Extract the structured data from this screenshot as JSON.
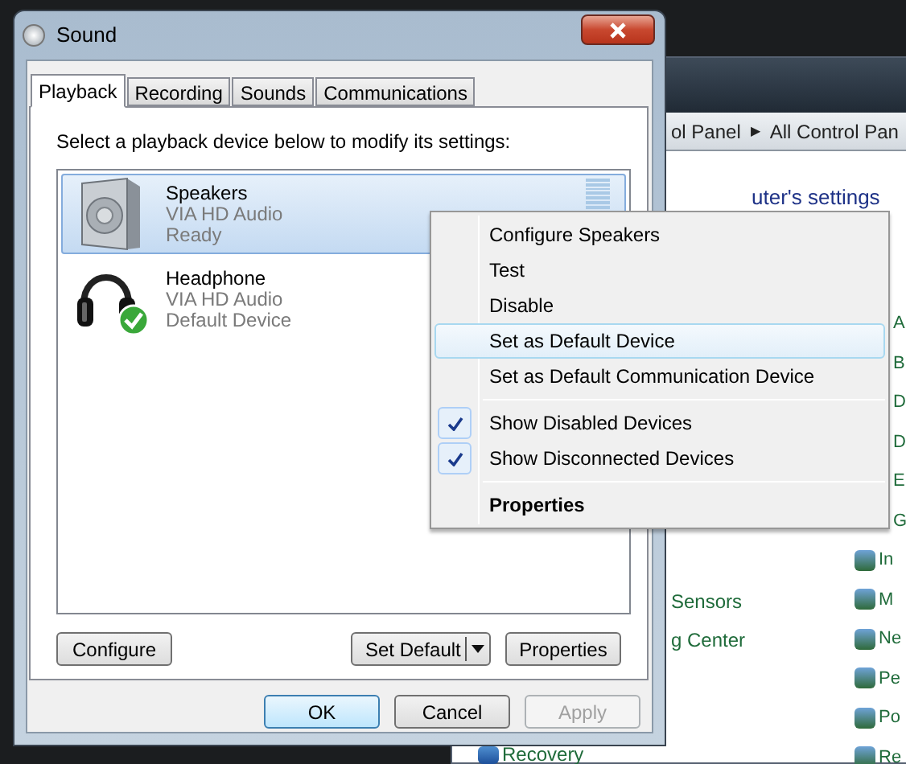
{
  "background_window": {
    "address": [
      "ol Panel",
      "All Control Pan"
    ],
    "address_separator": "▶",
    "heading": "uter's settings",
    "right_items": [
      {
        "label": "A",
        "icon": false
      },
      {
        "label": "B",
        "icon": false
      },
      {
        "label": "D",
        "icon": false
      },
      {
        "label": "D",
        "icon": false
      },
      {
        "label": "E",
        "icon": false
      },
      {
        "label": "G",
        "icon": false
      },
      {
        "label": "In",
        "icon": true
      },
      {
        "label": "M",
        "icon": true
      },
      {
        "label": "Ne",
        "icon": true
      },
      {
        "label": "Pe",
        "icon": true
      },
      {
        "label": "Po",
        "icon": true
      },
      {
        "label": "Re",
        "icon": true
      }
    ],
    "left_items": [
      "Sensors",
      "g Center"
    ],
    "bottom_item": "Recovery"
  },
  "window": {
    "title": "Sound"
  },
  "tabs": [
    {
      "label": "Playback",
      "selected": true
    },
    {
      "label": "Recording",
      "selected": false
    },
    {
      "label": "Sounds",
      "selected": false
    },
    {
      "label": "Communications",
      "selected": false
    }
  ],
  "instruction": "Select a playback device below to modify its settings:",
  "devices": [
    {
      "kind": "speaker",
      "name": "Speakers",
      "driver": "VIA HD Audio",
      "status": "Ready",
      "selected": true,
      "default": false,
      "level": 0
    },
    {
      "kind": "headphone",
      "name": "Headphone",
      "driver": "VIA HD Audio",
      "status": "Default Device",
      "selected": false,
      "default": true
    }
  ],
  "panel_buttons": {
    "configure": "Configure",
    "set_default": "Set Default",
    "properties": "Properties"
  },
  "dialog_buttons": [
    {
      "label": "OK",
      "focused": true,
      "disabled": false
    },
    {
      "label": "Cancel",
      "focused": false,
      "disabled": false
    },
    {
      "label": "Apply",
      "focused": false,
      "disabled": true
    }
  ],
  "context_menu": [
    {
      "kind": "item",
      "label": "Configure Speakers",
      "checked": false,
      "selected": false,
      "bold": false
    },
    {
      "kind": "item",
      "label": "Test",
      "checked": false,
      "selected": false,
      "bold": false
    },
    {
      "kind": "item",
      "label": "Disable",
      "checked": false,
      "selected": false,
      "bold": false
    },
    {
      "kind": "item",
      "label": "Set as Default Device",
      "checked": false,
      "selected": true,
      "bold": false
    },
    {
      "kind": "item",
      "label": "Set as Default Communication Device",
      "checked": false,
      "selected": false,
      "bold": false
    },
    {
      "kind": "separator"
    },
    {
      "kind": "item",
      "label": "Show Disabled Devices",
      "checked": true,
      "selected": false,
      "bold": false
    },
    {
      "kind": "item",
      "label": "Show Disconnected Devices",
      "checked": true,
      "selected": false,
      "bold": false
    },
    {
      "kind": "separator"
    },
    {
      "kind": "item",
      "label": "Properties",
      "checked": false,
      "selected": false,
      "bold": true
    }
  ]
}
